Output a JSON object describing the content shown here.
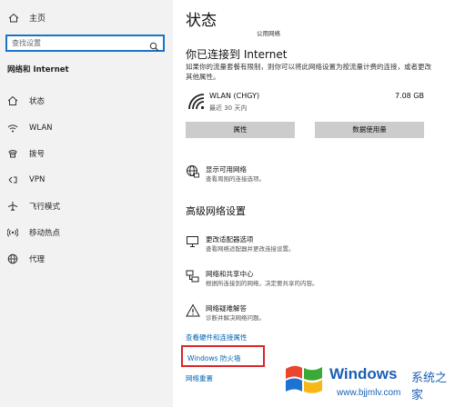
{
  "sidebar": {
    "home_label": "主页",
    "search_placeholder": "查找设置",
    "section_title": "网络和 Internet",
    "items": [
      {
        "label": "状态",
        "icon": "home-network-icon"
      },
      {
        "label": "WLAN",
        "icon": "wifi-icon"
      },
      {
        "label": "拨号",
        "icon": "dialup-icon"
      },
      {
        "label": "VPN",
        "icon": "vpn-icon"
      },
      {
        "label": "飞行模式",
        "icon": "airplane-icon"
      },
      {
        "label": "移动热点",
        "icon": "hotspot-icon"
      },
      {
        "label": "代理",
        "icon": "globe-icon"
      }
    ]
  },
  "main": {
    "title": "状态",
    "network_tag": "公用网络",
    "connected_heading": "你已连接到 Internet",
    "connected_desc": "如果你的流量套餐有限制，则你可以将此网络设置为按流量计费的连接，或者更改其他属性。",
    "wlan": {
      "name": "WLAN (CHGY)",
      "time": "最近 30 天内",
      "size": "7.08 GB"
    },
    "buttons": {
      "properties": "属性",
      "data_usage": "数据使用量"
    },
    "show_networks": {
      "title": "显示可用网络",
      "subtitle": "查看周围的连接选项。"
    },
    "advanced_heading": "高级网络设置",
    "advanced": [
      {
        "title": "更改适配器选项",
        "subtitle": "查看网络适配器并更改连接设置。"
      },
      {
        "title": "网络和共享中心",
        "subtitle": "根据所连接到的网络，决定要共享的内容。"
      },
      {
        "title": "网络疑难解答",
        "subtitle": "诊断并解决网络问题。"
      }
    ],
    "links": {
      "hardware": "查看硬件和连接属性",
      "firewall": "Windows 防火墙",
      "reset": "网络重置"
    }
  },
  "watermark": {
    "brand": "Windows",
    "cn": "系统之家",
    "url": "www.bjjmlv.com"
  },
  "colors": {
    "accent": "#0063b1",
    "highlight_box": "#d8262a",
    "sidebar_bg": "#f2f2f2"
  }
}
